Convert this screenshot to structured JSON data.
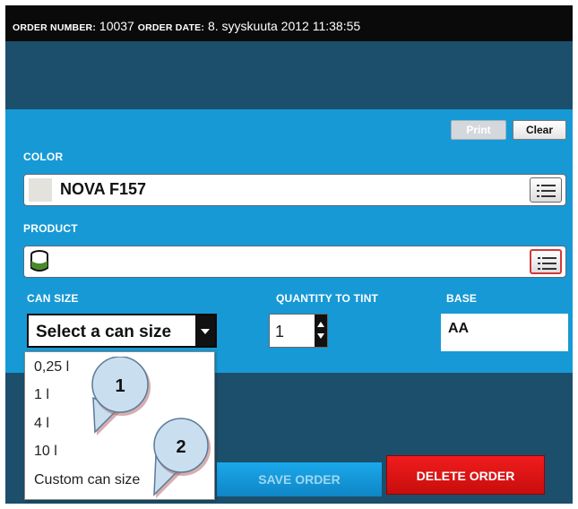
{
  "header": {
    "order_number_label": "ORDER NUMBER:",
    "order_number": "10037",
    "order_date_label": "ORDER DATE:",
    "order_date": "8. syyskuuta 2012 11:38:55"
  },
  "toolbar": {
    "print_label": "Print",
    "clear_label": "Clear"
  },
  "color": {
    "label": "COLOR",
    "value": "NOVA F157",
    "swatch_color": "#e4e2dc"
  },
  "product": {
    "label": "PRODUCT",
    "value": "",
    "icon": "can-icon"
  },
  "can_size": {
    "label": "CAN SIZE",
    "selected": "Select a can size",
    "options": [
      "0,25 l",
      "1 l",
      "4 l",
      "10 l",
      "Custom can size"
    ]
  },
  "quantity": {
    "label": "QUANTITY TO TINT",
    "value": "1"
  },
  "base": {
    "label": "BASE",
    "value": "AA"
  },
  "actions": {
    "save_label": "SAVE ORDER",
    "delete_label": "DELETE ORDER"
  },
  "callouts": [
    {
      "number": "1"
    },
    {
      "number": "2"
    }
  ],
  "colors": {
    "header_bg": "#0a0a0a",
    "panel_dark": "#1b4f6b",
    "panel_blue": "#1799d6",
    "delete_red": "#e01414",
    "callout_blue": "#c9dff0"
  }
}
